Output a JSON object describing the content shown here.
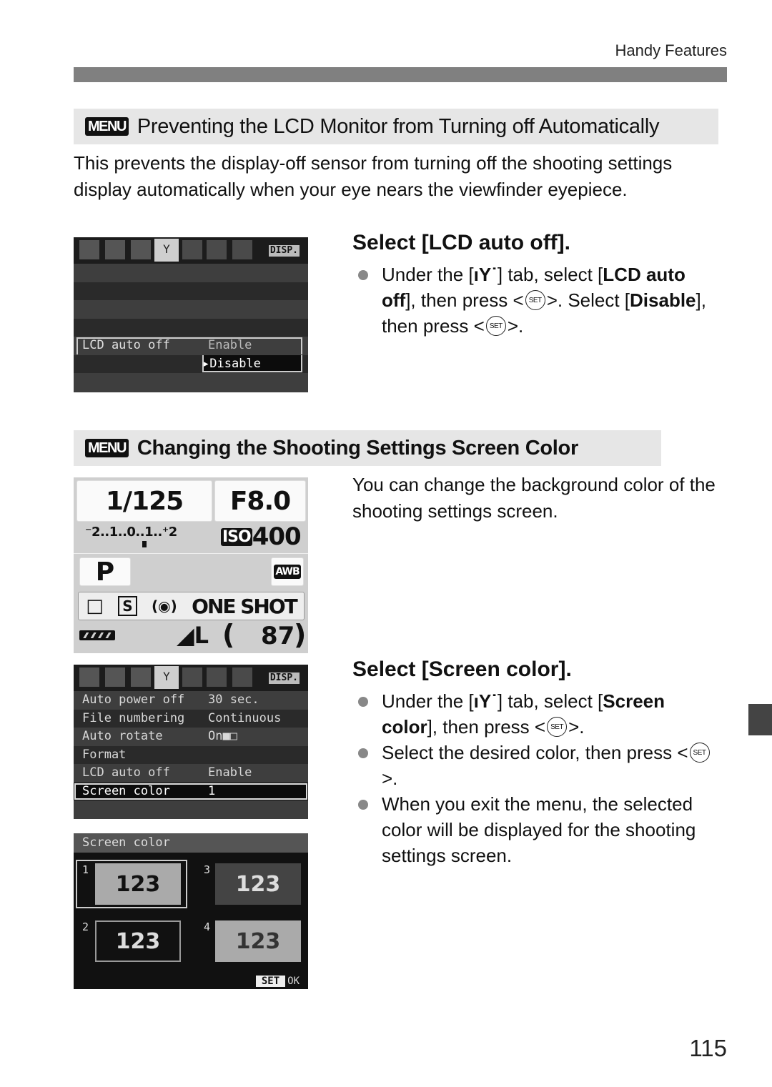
{
  "running_head": "Handy Features",
  "page_number": "115",
  "menu_badge": "MENU",
  "set_icon": "SET",
  "setup_tab_glyph": "ıY˙",
  "section1": {
    "title": "Preventing the LCD Monitor from Turning off Automatically",
    "intro": "This prevents the display-off sensor from turning off the shooting settings display automatically when your eye nears the viewfinder eyepiece.",
    "step_title": "Select [LCD auto off].",
    "bullet": {
      "p1": "Under the [",
      "p2": "] tab, select [",
      "b1": "LCD auto off",
      "p3": "], then press <",
      "p4": ">. Select [",
      "b2": "Disable",
      "p5": "], then press <",
      "p6": ">."
    },
    "lcd": {
      "tabs_right": "DISP.",
      "menu_item": "LCD auto off",
      "options": [
        "Enable",
        "Disable"
      ],
      "selected_option": "Disable"
    }
  },
  "section2": {
    "title": "Changing the Shooting Settings Screen Color",
    "intro": "You can change the background color of the shooting settings screen.",
    "step_title": "Select [Screen color].",
    "bullets": [
      {
        "p1": "Under the [",
        "p2": "] tab, select [",
        "b1": "Screen color",
        "p3": "], then press <",
        "p4": ">."
      },
      {
        "p1": "Select the desired color, then press <",
        "p2": ">."
      },
      {
        "text": "When you exit the menu, the selected color will be displayed for the shooting settings screen."
      }
    ],
    "shooting_screen": {
      "shutter": "1/125",
      "aperture": "F8.0",
      "exposure_scale": "⁻2..1..0..1..⁺2",
      "iso_label": "ISO",
      "iso_value": "400",
      "mode": "P",
      "wb": "AWB",
      "drive": "□",
      "picture_style": "S",
      "metering": "(◉)",
      "af_mode": "ONE SHOT",
      "quality": "◢L",
      "shots_remaining": "87"
    },
    "setup_menu": {
      "tabs_right": "DISP.",
      "items": [
        {
          "label": "Auto power off",
          "value": "30 sec."
        },
        {
          "label": "File numbering",
          "value": "Continuous"
        },
        {
          "label": "Auto rotate",
          "value": "On■□"
        },
        {
          "label": "Format",
          "value": ""
        },
        {
          "label": "LCD auto off",
          "value": "Enable"
        },
        {
          "label": "Screen color",
          "value": "1"
        }
      ],
      "selected_index": 5
    },
    "screen_color_dialog": {
      "title": "Screen color",
      "options": [
        {
          "num": "1",
          "sample": "123"
        },
        {
          "num": "2",
          "sample": "123"
        },
        {
          "num": "3",
          "sample": "123"
        },
        {
          "num": "4",
          "sample": "123"
        }
      ],
      "selected": "1",
      "set_key": "SET",
      "ok_label": "OK"
    }
  }
}
